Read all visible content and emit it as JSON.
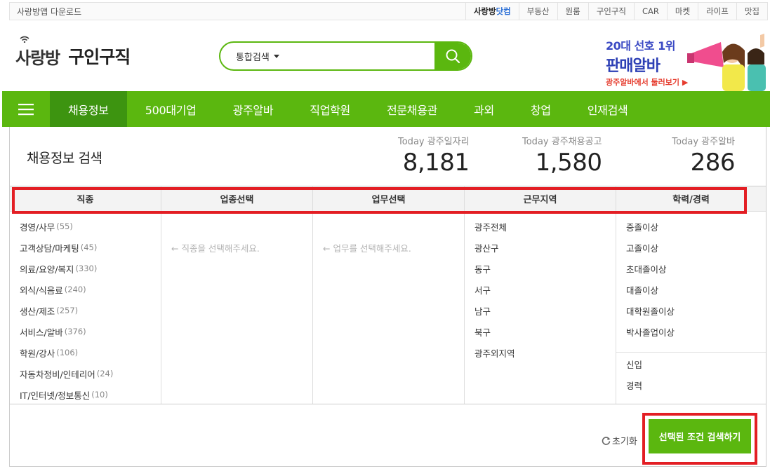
{
  "topbar": {
    "download": "사랑방앱 다운로드",
    "links": [
      {
        "label_a": "사랑방",
        "label_b": "닷컴",
        "bold": true
      },
      {
        "label_a": "부동산",
        "label_b": "",
        "bold": false
      },
      {
        "label_a": "원룸",
        "label_b": "",
        "bold": false
      },
      {
        "label_a": "구인구직",
        "label_b": "",
        "bold": false
      },
      {
        "label_a": "CAR",
        "label_b": "",
        "bold": false
      },
      {
        "label_a": "마켓",
        "label_b": "",
        "bold": false
      },
      {
        "label_a": "라이프",
        "label_b": "",
        "bold": false
      },
      {
        "label_a": "맛집",
        "label_b": "",
        "bold": false
      }
    ]
  },
  "header": {
    "logo_brand": "사랑방",
    "logo_sub": "구인구직",
    "search_scope": "통합검색",
    "search_placeholder": ""
  },
  "banner": {
    "line1": "20대 선호 1위",
    "line2": "판매알바",
    "line3": "광주알바에서 둘러보기 ▶"
  },
  "nav": {
    "items": [
      "채용정보",
      "500대기업",
      "광주알바",
      "직업학원",
      "전문채용관",
      "과외",
      "창업",
      "인재검색"
    ],
    "active_index": 0
  },
  "panel": {
    "title": "채용정보 검색",
    "stats": [
      {
        "label": "Today 광주일자리",
        "value": "8,181"
      },
      {
        "label": "Today 광주채용공고",
        "value": "1,580"
      },
      {
        "label": "Today 광주알바",
        "value": "286"
      }
    ]
  },
  "filters": {
    "headers": [
      "직종",
      "업종선택",
      "업무선택",
      "근무지역",
      "학력/경력"
    ],
    "jobs": [
      {
        "name": "경영/사무",
        "count": "(55)"
      },
      {
        "name": "고객상담/마케팅",
        "count": "(45)"
      },
      {
        "name": "의료/요양/복지",
        "count": "(330)"
      },
      {
        "name": "외식/식음료",
        "count": "(240)"
      },
      {
        "name": "생산/제조",
        "count": "(257)"
      },
      {
        "name": "서비스/알바",
        "count": "(376)"
      },
      {
        "name": "학원/강사",
        "count": "(106)"
      },
      {
        "name": "자동차정비/인테리어",
        "count": "(24)"
      },
      {
        "name": "IT/인터넷/정보통신",
        "count": "(10)"
      }
    ],
    "industry_hint": "← 직종을 선택해주세요.",
    "task_hint": "← 업무를 선택해주세요.",
    "regions": [
      "광주전체",
      "광산구",
      "동구",
      "서구",
      "남구",
      "북구",
      "광주외지역"
    ],
    "education": [
      "중졸이상",
      "고졸이상",
      "초대졸이상",
      "대졸이상",
      "대학원졸이상",
      "박사졸업이상"
    ],
    "experience": [
      "신입",
      "경력"
    ]
  },
  "actions": {
    "reset": "초기화",
    "search": "선택된 조건 검색하기"
  },
  "colors": {
    "accent": "#5bb70f",
    "accent_dark": "#3d9410",
    "highlight": "#e31e24"
  }
}
